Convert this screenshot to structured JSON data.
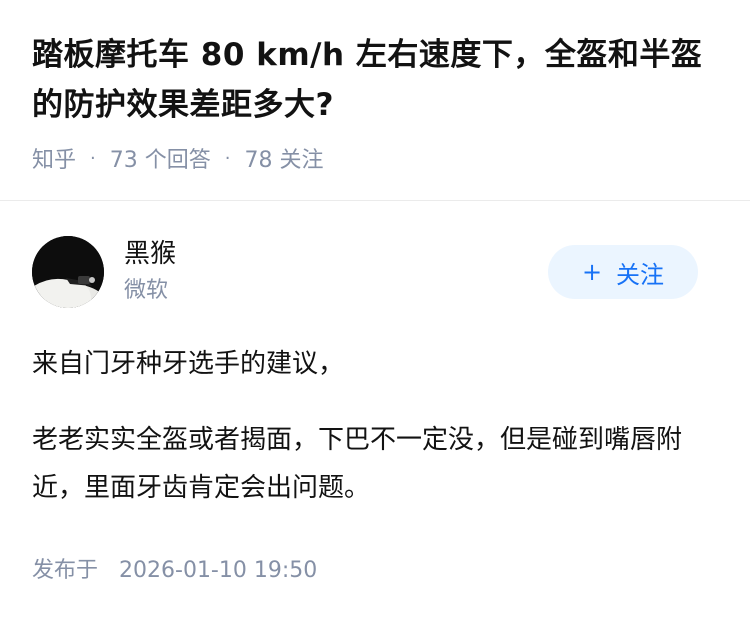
{
  "question": {
    "title": "踏板摩托车 80 km/h 左右速度下，全盔和半盔的防护效果差距多大?",
    "source": "知乎",
    "answers": "73 个回答",
    "followers": "78 关注"
  },
  "author": {
    "name": "黑猴",
    "subtitle": "微软",
    "follow_label": "关注",
    "follow_icon": "plus-icon"
  },
  "answer": {
    "paragraphs": [
      "来自门牙种牙选手的建议，",
      "老老实实全盔或者揭面，下巴不一定没，但是碰到嘴唇附近，里面牙齿肯定会出问题。"
    ],
    "published_label": "发布于",
    "published_time": "2026-01-10 19:50"
  },
  "colors": {
    "accent": "#1772f6",
    "follow_bg": "#ebf5ff",
    "meta": "#8590a6",
    "text": "#121212"
  }
}
